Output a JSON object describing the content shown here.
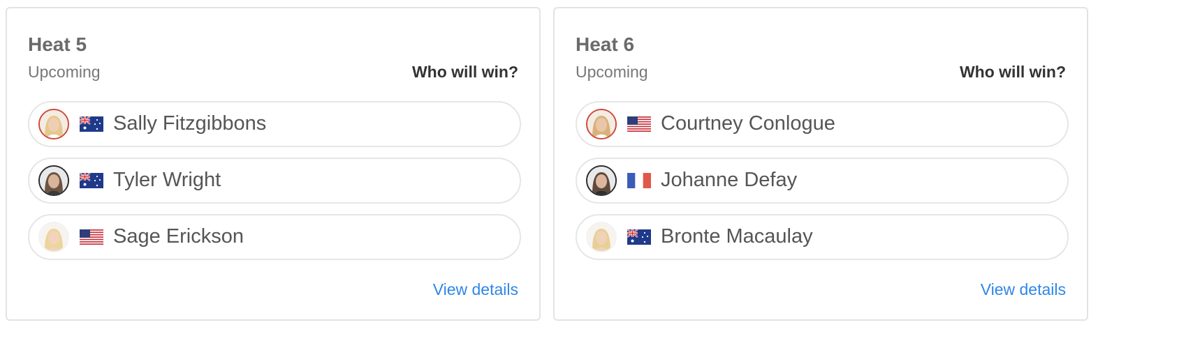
{
  "colors": {
    "link": "#2f86e8",
    "card_border": "#e3e3e3",
    "ring_red": "#d0463b",
    "ring_dark": "#2a2a2a"
  },
  "heats": [
    {
      "title": "Heat 5",
      "status": "Upcoming",
      "prompt": "Who will win?",
      "details_label": "View details",
      "surfers": [
        {
          "name": "Sally Fitzgibbons",
          "flag": "australia-flag-icon",
          "avatar": "blonde-surfer-photo"
        },
        {
          "name": "Tyler Wright",
          "flag": "australia-flag-icon",
          "avatar": "brunette-surfer-photo"
        },
        {
          "name": "Sage Erickson",
          "flag": "usa-flag-icon",
          "avatar": "blonde-surfer-photo"
        }
      ]
    },
    {
      "title": "Heat 6",
      "status": "Upcoming",
      "prompt": "Who will win?",
      "details_label": "View details",
      "surfers": [
        {
          "name": "Courtney Conlogue",
          "flag": "usa-flag-icon",
          "avatar": "blonde-surfer-photo"
        },
        {
          "name": "Johanne Defay",
          "flag": "france-flag-icon",
          "avatar": "brunette-surfer-photo"
        },
        {
          "name": "Bronte Macaulay",
          "flag": "australia-flag-icon",
          "avatar": "blonde-surfer-photo"
        }
      ]
    }
  ]
}
